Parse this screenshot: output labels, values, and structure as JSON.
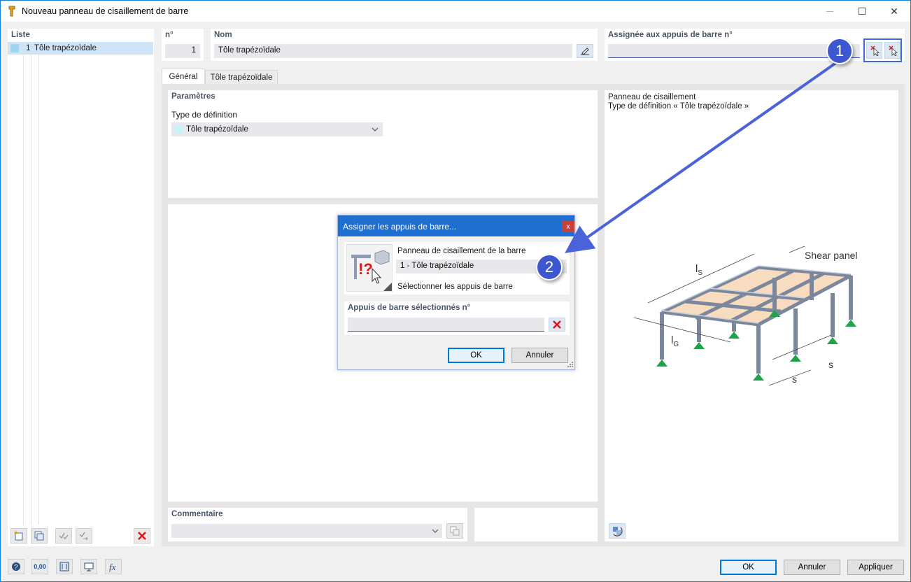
{
  "window": {
    "title": "Nouveau panneau de cisaillement de barre",
    "minimize": "—",
    "maximize": "☐",
    "close": "✕"
  },
  "list": {
    "header": "Liste",
    "items": [
      {
        "num": "1",
        "label": "Tôle trapézoïdale"
      }
    ]
  },
  "fields": {
    "number_label": "n°",
    "number_value": "1",
    "name_label": "Nom",
    "name_value": "Tôle trapézoïdale",
    "assigned_label": "Assignée aux appuis de barre n°",
    "assigned_value": ""
  },
  "tabs": [
    {
      "label": "Général",
      "active": true
    },
    {
      "label": "Tôle trapézoïdale",
      "active": false
    }
  ],
  "params": {
    "section_title": "Paramètres",
    "def_type_label": "Type de définition",
    "def_type_value": "Tôle trapézoïdale"
  },
  "preview": {
    "line1": "Panneau de cisaillement",
    "line2": "Type de définition « Tôle trapézoïdale »",
    "shear_panel_label": "Shear panel",
    "ls_label": "l",
    "ls_sub": "S",
    "lg_label": "l",
    "lg_sub": "G",
    "s_label": "s"
  },
  "comment": {
    "label": "Commentaire",
    "value": ""
  },
  "subdialog": {
    "title": "Assigner les appuis de barre...",
    "close": "x",
    "panel_label": "Panneau de cisaillement de la barre",
    "panel_value": "1 - Tôle trapézoïdale",
    "select_text": "Sélectionner les appuis de barre",
    "selected_label": "Appuis de barre sélectionnés n°",
    "selected_value": "",
    "ok": "OK",
    "cancel": "Annuler"
  },
  "badges": {
    "one": "1",
    "two": "2"
  },
  "footer": {
    "ok": "OK",
    "cancel": "Annuler",
    "apply": "Appliquer",
    "units_icon_text": "0,00"
  },
  "colors": {
    "accent": "#0078d7",
    "badge": "#3c57d0",
    "arrow": "#4a63d8",
    "delete_red": "#e01818",
    "support_green": "#1fa34a",
    "panel_fill": "#f7dcc0"
  }
}
